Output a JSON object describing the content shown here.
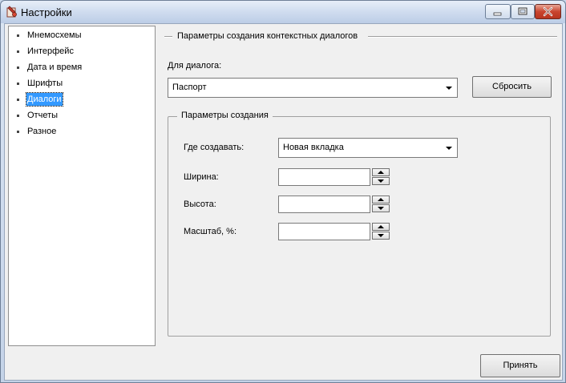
{
  "window": {
    "title": "Настройки",
    "icon": "app-settings-icon"
  },
  "sidebar": {
    "items": [
      {
        "label": "Мнемосхемы",
        "selected": false
      },
      {
        "label": "Интерфейс",
        "selected": false
      },
      {
        "label": "Дата и время",
        "selected": false
      },
      {
        "label": "Шрифты",
        "selected": false
      },
      {
        "label": "Диалоги",
        "selected": true
      },
      {
        "label": "Отчеты",
        "selected": false
      },
      {
        "label": "Разное",
        "selected": false
      }
    ]
  },
  "main": {
    "section_title": "Параметры создания контекстных диалогов",
    "dialog_label": "Для диалога:",
    "dialog_value": "Паспорт",
    "reset_label": "Сбросить",
    "group_title": "Параметры создания",
    "where_label": "Где создавать:",
    "where_value": "Новая вкладка",
    "width_label": "Ширина:",
    "width_value": "",
    "height_label": "Высота:",
    "height_value": "",
    "scale_label": "Масштаб, %:",
    "scale_value": ""
  },
  "footer": {
    "accept_label": "Принять"
  },
  "colors": {
    "selection": "#3399ff",
    "close_button": "#c9452f"
  }
}
